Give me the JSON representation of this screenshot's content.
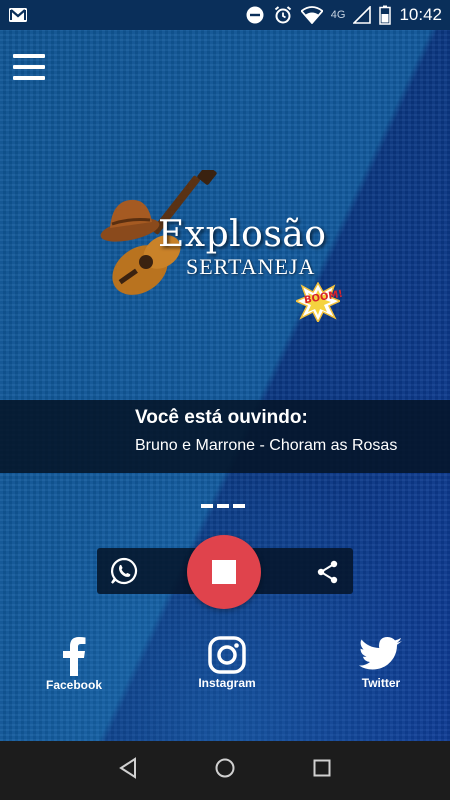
{
  "status_bar": {
    "time": "10:42",
    "network": "4G",
    "icons": [
      "gmail-icon",
      "do-not-disturb-icon",
      "alarm-icon",
      "wifi-icon",
      "cell-signal-icon",
      "battery-icon"
    ]
  },
  "app": {
    "menu_icon": "hamburger-menu-icon",
    "logo": {
      "title": "Explosão",
      "subtitle": "SERTANEJA",
      "badge": "BOOM!"
    }
  },
  "now_playing": {
    "label": "Você está ouvindo:",
    "track": "Bruno e Marrone - Choram as Rosas"
  },
  "player": {
    "left_icon": "whatsapp-icon",
    "center_icon": "stop-icon",
    "right_icon": "share-icon",
    "accent_color": "#e0434c"
  },
  "social": [
    {
      "label": "Facebook",
      "icon": "facebook-icon"
    },
    {
      "label": "Instagram",
      "icon": "instagram-icon"
    },
    {
      "label": "Twitter",
      "icon": "twitter-icon"
    }
  ],
  "nav_bar": {
    "icons": [
      "back-icon",
      "home-icon",
      "recents-icon"
    ]
  }
}
